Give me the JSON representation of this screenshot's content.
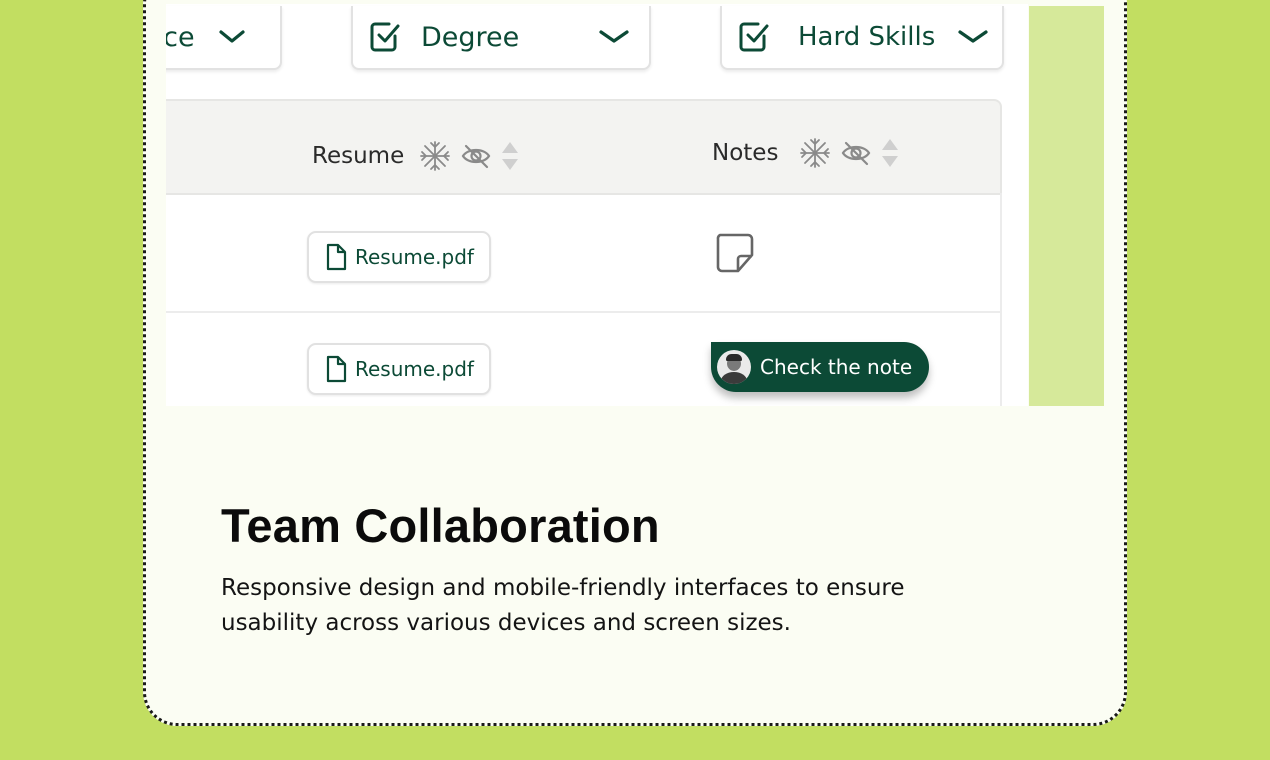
{
  "filters": [
    {
      "label": "nce",
      "icon": "chevron-down-icon"
    },
    {
      "label": "Degree",
      "icon": "checkbox-checked-icon"
    },
    {
      "label": "Hard Skills",
      "icon": "checkbox-checked-icon"
    }
  ],
  "table": {
    "columns": [
      {
        "label": "Resume",
        "icons": [
          "freeze-icon",
          "hide-icon",
          "sort-icon"
        ]
      },
      {
        "label": "Notes",
        "icons": [
          "freeze-icon",
          "hide-icon",
          "sort-icon"
        ]
      }
    ],
    "rows": [
      {
        "resume": "Resume.pdf",
        "note_state": "empty"
      },
      {
        "resume": "Resume.pdf",
        "note_state": "has-note",
        "note_label": "Check the note"
      }
    ]
  },
  "feature": {
    "title": "Team Collaboration",
    "description": "Responsive design and mobile-friendly interfaces to ensure usability across various devices and screen sizes."
  },
  "colors": {
    "background": "#c2de61",
    "card": "#fbfdf3",
    "brand_green": "#0c4a36",
    "accent_strip": "#d6e99a"
  }
}
